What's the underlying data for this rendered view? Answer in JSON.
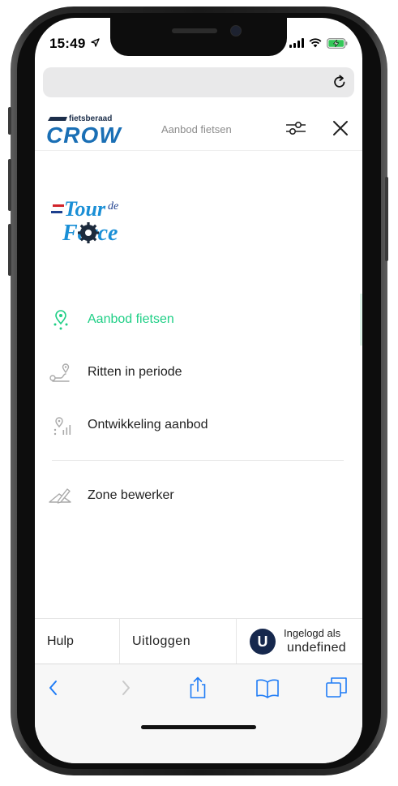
{
  "status_bar": {
    "time": "15:49",
    "location_icon": "location-arrow-icon",
    "signal_icon": "cellular-signal-icon",
    "wifi_icon": "wifi-icon",
    "battery_icon": "battery-charging-icon"
  },
  "browser": {
    "url": "",
    "reload_icon": "reload-icon"
  },
  "header": {
    "logo_top": "fietsberaad",
    "logo_main": "CROW",
    "title": "Aanbod fietsen",
    "filter_icon": "sliders-icon",
    "close_icon": "close-icon"
  },
  "brand": {
    "word1": "Tour",
    "word2": "de",
    "word3": "Force",
    "logo_icon": "tour-de-force-logo"
  },
  "menu": {
    "items": [
      {
        "label": "Aanbod fietsen",
        "icon": "map-pin-dots-icon",
        "active": true
      },
      {
        "label": "Ritten in periode",
        "icon": "route-icon",
        "active": false
      },
      {
        "label": "Ontwikkeling aanbod",
        "icon": "pin-bars-icon",
        "active": false
      },
      {
        "label": "Zone bewerker",
        "icon": "pencil-area-icon",
        "active": false
      }
    ]
  },
  "footer": {
    "help": "Hulp",
    "logout": "Uitloggen",
    "avatar_initial": "U",
    "logged_in_label": "Ingelogd als",
    "logged_in_user": "undefined"
  },
  "toolbar": {
    "back_icon": "chevron-left-icon",
    "forward_icon": "chevron-right-icon",
    "share_icon": "share-icon",
    "bookmarks_icon": "book-icon",
    "tabs_icon": "tabs-icon"
  },
  "colors": {
    "accent_green": "#1fcf86",
    "navy": "#16284d",
    "crow_blue": "#1a6fb5"
  }
}
